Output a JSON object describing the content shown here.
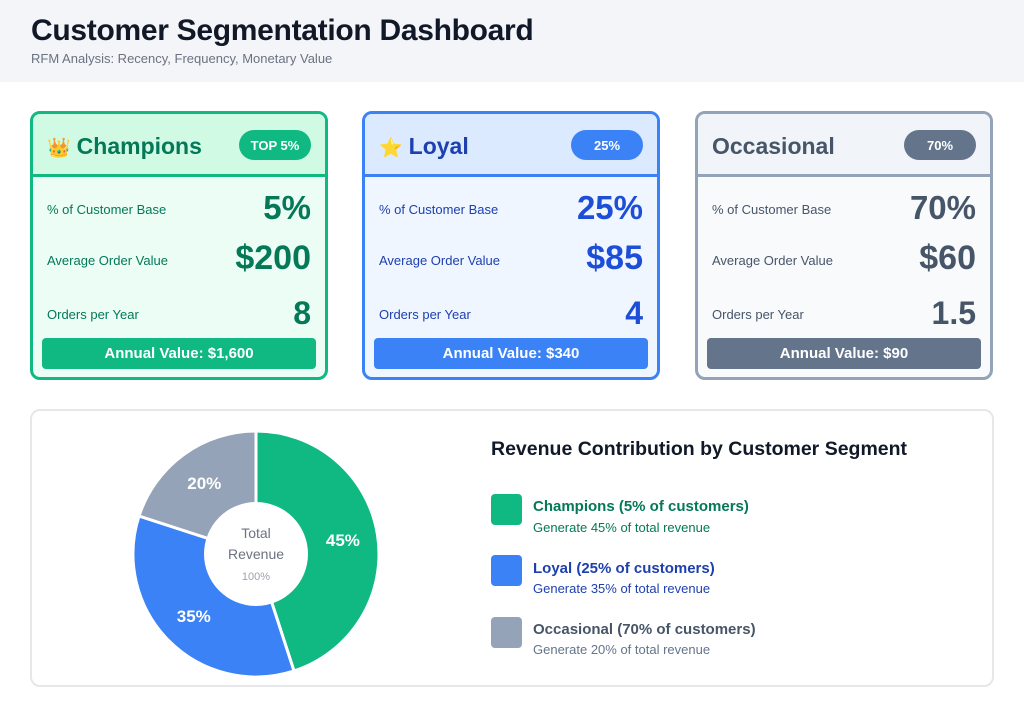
{
  "header": {
    "title": "Customer Segmentation Dashboard",
    "subtitle": "RFM Analysis: Recency, Frequency, Monetary Value"
  },
  "cards": [
    {
      "name": "Champions",
      "emoji": "👑",
      "badge": "TOP 5%",
      "pct_label": "% of Customer Base",
      "pct_value": "5%",
      "aov_label": "Average Order Value",
      "aov_value": "$200",
      "orders_label": "Orders per Year",
      "orders_value": "8",
      "annual": "Annual Value: $1,600",
      "color": "#10b981"
    },
    {
      "name": "Loyal",
      "emoji": "⭐",
      "badge": "25%",
      "pct_label": "% of Customer Base",
      "pct_value": "25%",
      "aov_label": "Average Order Value",
      "aov_value": "$85",
      "orders_label": "Orders per Year",
      "orders_value": "4",
      "annual": "Annual Value: $340",
      "color": "#3b82f6"
    },
    {
      "name": "Occasional",
      "emoji": "",
      "badge": "70%",
      "pct_label": "% of Customer Base",
      "pct_value": "70%",
      "aov_label": "Average Order Value",
      "aov_value": "$60",
      "orders_label": "Orders per Year",
      "orders_value": "1.5",
      "annual": "Annual Value: $90",
      "color": "#64748b"
    }
  ],
  "chart_data": {
    "type": "pie",
    "title": "Revenue Contribution by Customer Segment",
    "center_label_line1": "Total",
    "center_label_line2": "Revenue",
    "center_value": "100%",
    "slices": [
      {
        "label": "Champions",
        "value": 45,
        "display": "45%",
        "color": "#10b981"
      },
      {
        "label": "Loyal",
        "value": 35,
        "display": "35%",
        "color": "#3b82f6"
      },
      {
        "label": "Occasional",
        "value": 20,
        "display": "20%",
        "color": "#94a3b8"
      }
    ]
  },
  "legend": [
    {
      "name": "Champions (5% of customers)",
      "desc": "Generate 45% of total revenue",
      "color": "#10b981",
      "name_color": "#047857",
      "desc_color": "#047857"
    },
    {
      "name": "Loyal (25% of customers)",
      "desc": "Generate 35% of total revenue",
      "color": "#3b82f6",
      "name_color": "#1e40af",
      "desc_color": "#1e40af"
    },
    {
      "name": "Occasional (70% of customers)",
      "desc": "Generate 20% of total revenue",
      "color": "#94a3b8",
      "name_color": "#475569",
      "desc_color": "#64748b"
    }
  ]
}
